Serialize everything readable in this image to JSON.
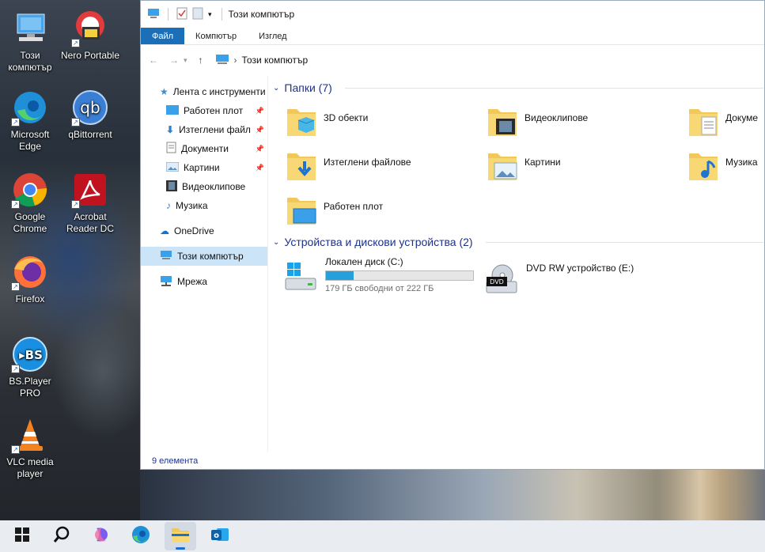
{
  "desktop": {
    "icons": [
      {
        "label": "Този компютър",
        "icon": "computer-icon"
      },
      {
        "label": "Nero Portable",
        "icon": "nero-icon"
      },
      {
        "label": "Microsoft Edge",
        "icon": "edge-icon"
      },
      {
        "label": "qBittorrent",
        "icon": "qbittorrent-icon"
      },
      {
        "label": "Google Chrome",
        "icon": "chrome-icon"
      },
      {
        "label": "Acrobat Reader DC",
        "icon": "acrobat-icon"
      },
      {
        "label": "Firefox",
        "icon": "firefox-icon"
      },
      {
        "label": "BS.Player PRO",
        "icon": "bsplayer-icon"
      },
      {
        "label": "VLC media player",
        "icon": "vlc-icon"
      }
    ]
  },
  "window": {
    "title": "Този компютър",
    "ribbon_tabs": [
      "Файл",
      "Компютър",
      "Изглед"
    ],
    "address": "Този компютър",
    "nav": {
      "quick_access": "Лента с инструменти",
      "quick_items": [
        "Работен плот",
        "Изтеглени файл",
        "Документи",
        "Картини",
        "Видеоклипове",
        "Музика"
      ],
      "onedrive": "OneDrive",
      "this_pc": "Този компютър",
      "network": "Мрежа"
    },
    "folders_header": "Папки (7)",
    "folders": [
      "3D обекти",
      "Видеоклипове",
      "Докуме",
      "Изтеглени файлове",
      "Картини",
      "Музика",
      "Работен плот"
    ],
    "devices_header": "Устройства и дискови устройства (2)",
    "drives": [
      {
        "name": "Локален диск (C:)",
        "free": "179 ГБ свободни от 222 ГБ",
        "used_fraction": 0.19
      },
      {
        "name": "DVD RW устройство (E:)",
        "badge": "DVD"
      }
    ],
    "status": "9 елемента",
    "accent": "#1a6fb8"
  },
  "taskbar": {
    "items": [
      "start-icon",
      "search-icon",
      "copilot-icon",
      "edge-icon",
      "file-explorer-icon",
      "outlook-icon"
    ]
  }
}
